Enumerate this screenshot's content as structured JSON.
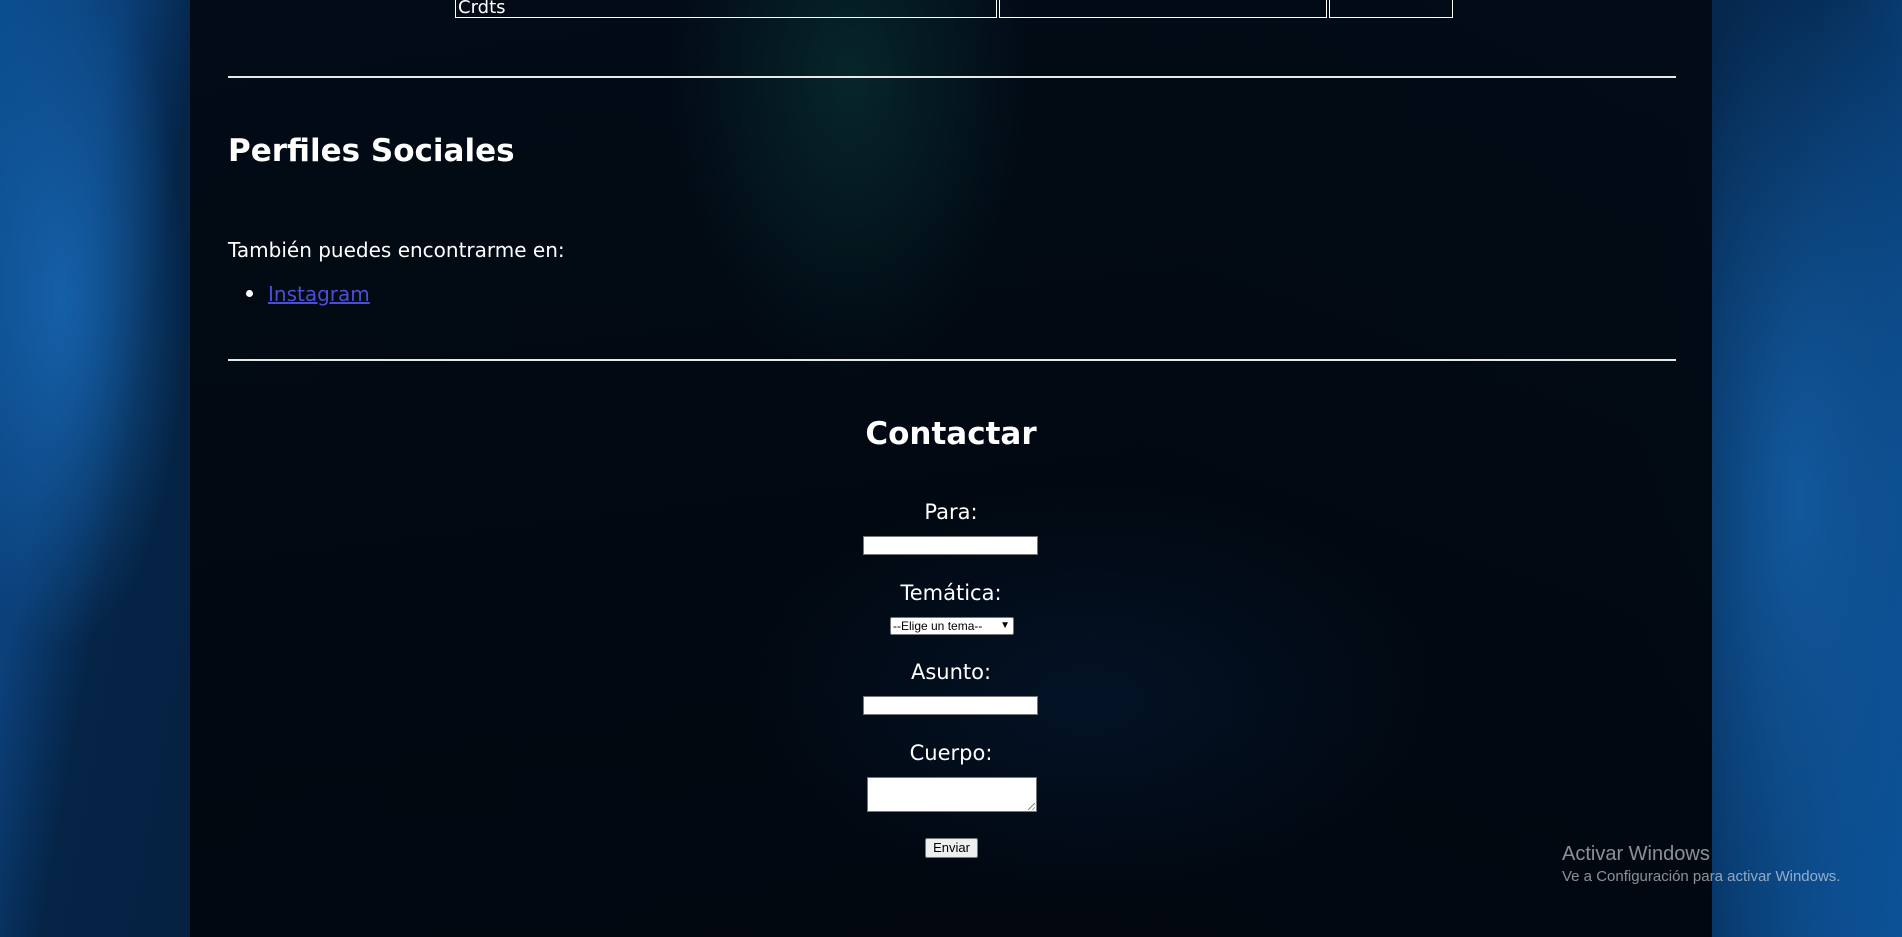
{
  "table": {
    "cells": [
      "Crdts",
      "",
      ""
    ]
  },
  "social": {
    "heading": "Perfiles Sociales",
    "intro": "También puedes encontrarme en:",
    "links": [
      "Instagram"
    ]
  },
  "contact": {
    "heading": "Contactar",
    "to_label": "Para:",
    "to_value": "",
    "topic_label": "Temática:",
    "topic_selected": "--Elige un tema--",
    "subject_label": "Asunto:",
    "subject_value": "",
    "body_label": "Cuerpo:",
    "body_value": "",
    "submit_label": "Enviar"
  },
  "watermark": {
    "title": "Activar Windows",
    "subtitle": "Ve a Configuración para activar Windows."
  },
  "icons": {
    "select_arrow": "chevron-down-icon",
    "resize": "resize-grip-icon",
    "bullet": "bullet-icon"
  },
  "colors": {
    "link": "#4b4fd6",
    "text": "#ffffff",
    "rule": "#e8e8e8"
  }
}
